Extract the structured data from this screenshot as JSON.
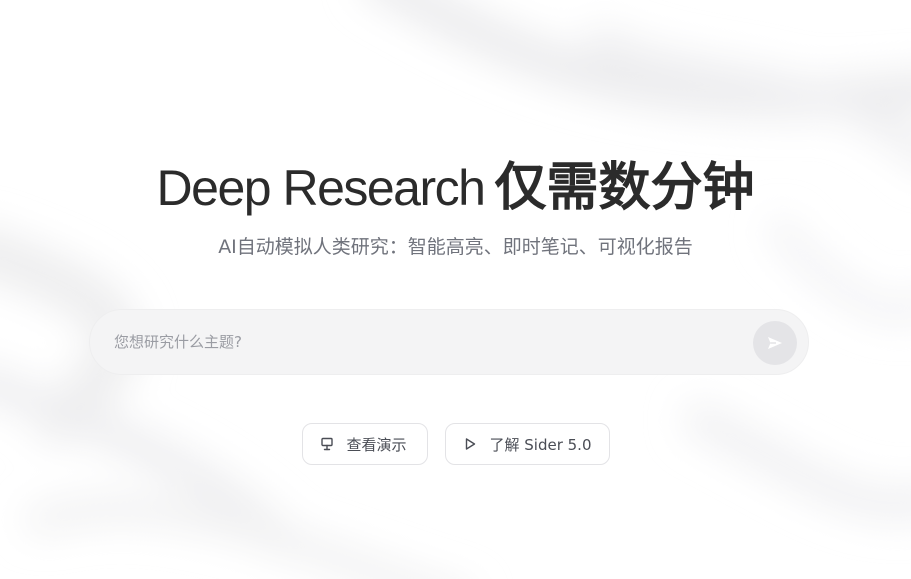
{
  "hero": {
    "title_en": "Deep Research",
    "title_zh": "仅需数分钟",
    "subtitle": "AI自动模拟人类研究：智能高亮、即时笔记、可视化报告"
  },
  "search": {
    "placeholder": "您想研究什么主题?",
    "value": ""
  },
  "actions": {
    "demo_label": "查看演示",
    "sider_label": "了解 Sider 5.0"
  },
  "icons": {
    "send": "send-icon",
    "demo": "presentation-icon",
    "sider": "play-icon"
  },
  "colors": {
    "title": "#2b2b2b",
    "subtitle": "#70737c",
    "search_bg": "#f4f4f5",
    "send_bg": "#e4e4e7"
  }
}
